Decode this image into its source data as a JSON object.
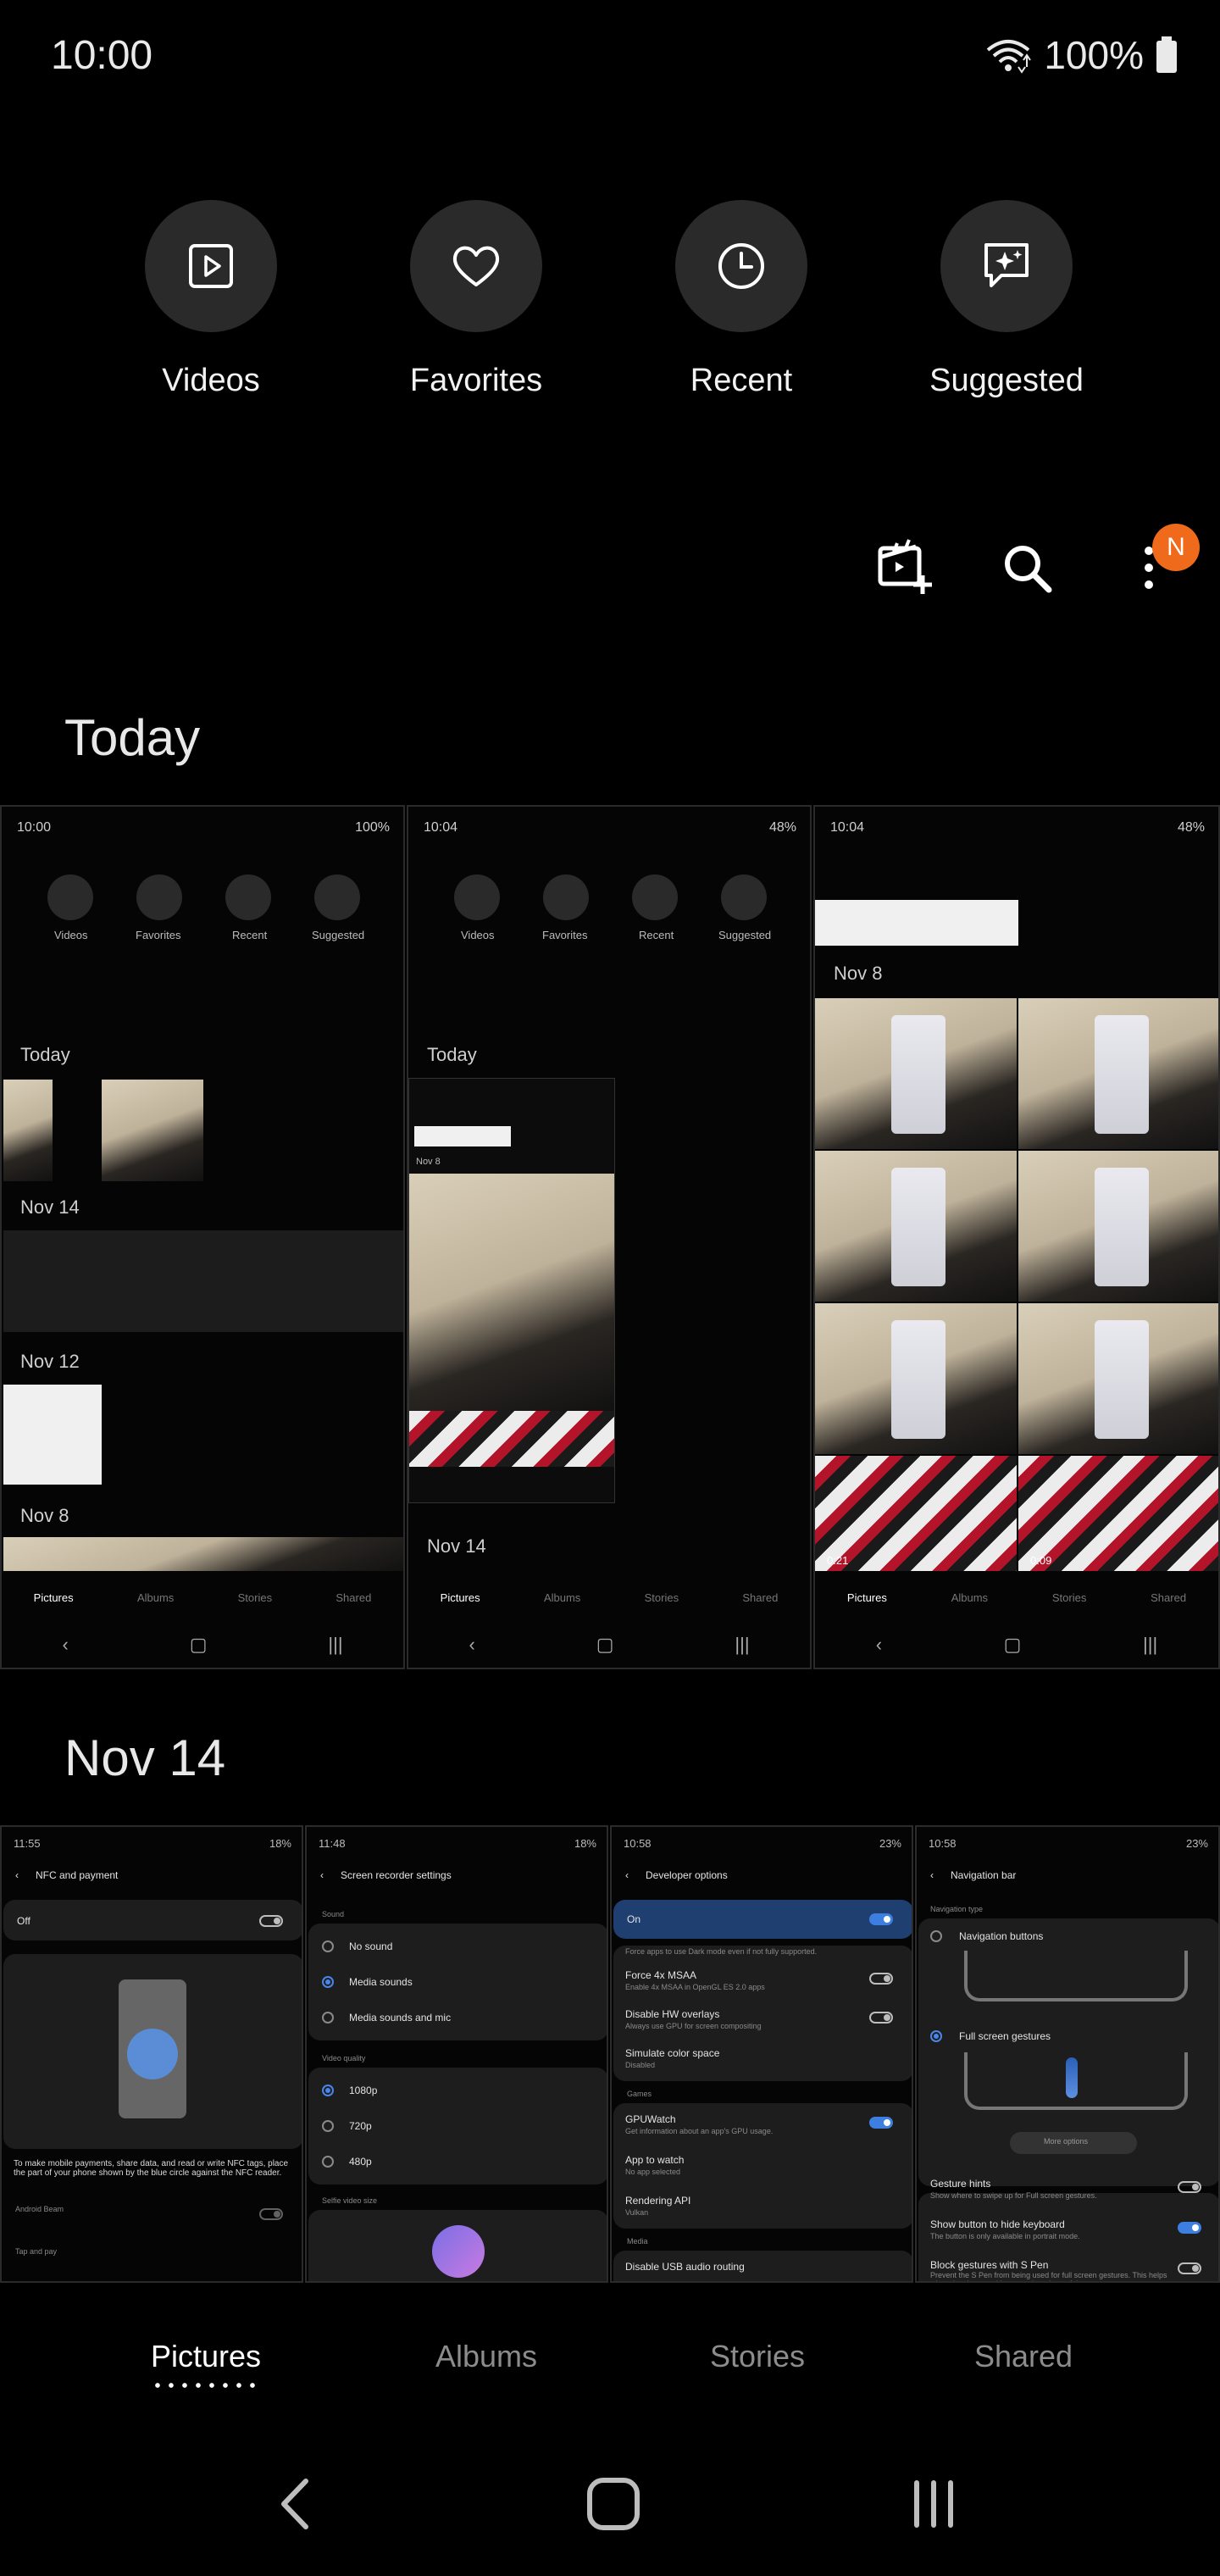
{
  "status": {
    "time": "10:00",
    "battery": "100%"
  },
  "quick_access": [
    {
      "label": "Videos",
      "icon": "play-square-icon"
    },
    {
      "label": "Favorites",
      "icon": "heart-icon"
    },
    {
      "label": "Recent",
      "icon": "clock-icon"
    },
    {
      "label": "Suggested",
      "icon": "sparkle-chat-icon"
    }
  ],
  "toolbar": {
    "badge": "N"
  },
  "sections": [
    {
      "title": "Today"
    },
    {
      "title": "Nov 14"
    }
  ],
  "today_shots": [
    {
      "time": "10:00",
      "battery": "100%",
      "labels": [
        "Videos",
        "Favorites",
        "Recent",
        "Suggested"
      ],
      "headers": [
        "Today",
        "Nov 14",
        "Nov 12",
        "Nov 8"
      ]
    },
    {
      "time": "10:04",
      "battery": "48%",
      "labels": [
        "Videos",
        "Favorites",
        "Recent",
        "Suggested"
      ],
      "headers": [
        "Today",
        "Nov 8",
        "Nov 14"
      ]
    },
    {
      "time": "10:04",
      "battery": "48%",
      "headers": [
        "Nov 8"
      ],
      "video_durations": [
        "0:21",
        "0:09"
      ]
    }
  ],
  "mini_tabs": [
    "Pictures",
    "Albums",
    "Stories",
    "Shared"
  ],
  "nov14_shots": {
    "nfc": {
      "time": "11:55",
      "battery": "18%",
      "title": "NFC and payment",
      "off_label": "Off",
      "desc": "To make mobile payments, share data, and read or write NFC tags, place the part of your phone shown by the blue circle against the NFC reader.",
      "row1": "Android Beam",
      "row2": "Tap and pay"
    },
    "recorder": {
      "time": "11:48",
      "battery": "18%",
      "title": "Screen recorder settings",
      "sound_header": "Sound",
      "sound_options": [
        "No sound",
        "Media sounds",
        "Media sounds and mic"
      ],
      "quality_header": "Video quality",
      "quality_options": [
        "1080p",
        "720p",
        "480p"
      ],
      "selfie_header": "Selfie video size"
    },
    "developer": {
      "time": "10:58",
      "battery": "23%",
      "title": "Developer options",
      "on_label": "On",
      "row0_sub": "Force apps to use Dark mode even if not fully supported.",
      "rows": [
        {
          "title": "Force 4x MSAA",
          "sub": "Enable 4x MSAA in OpenGL ES 2.0 apps"
        },
        {
          "title": "Disable HW overlays",
          "sub": "Always use GPU for screen compositing"
        },
        {
          "title": "Simulate color space",
          "sub": "Disabled"
        }
      ],
      "games_header": "Games",
      "rows2": [
        {
          "title": "GPUWatch",
          "sub": "Get information about an app's GPU usage."
        },
        {
          "title": "App to watch",
          "sub": "No app selected"
        },
        {
          "title": "Rendering API",
          "sub": "Vulkan"
        }
      ],
      "media_header": "Media",
      "last_row": "Disable USB audio routing"
    },
    "navbar": {
      "time": "10:58",
      "battery": "23%",
      "title": "Navigation bar",
      "type_header": "Navigation type",
      "opt1": "Navigation buttons",
      "opt2": "Full screen gestures",
      "more": "More options",
      "rows": [
        {
          "title": "Gesture hints",
          "sub": "Show where to swipe up for Full screen gestures."
        },
        {
          "title": "Show button to hide keyboard",
          "sub": "The button is only available in portrait mode."
        },
        {
          "title": "Block gestures with S Pen",
          "sub": "Prevent the S Pen from being used for full screen gestures. This helps when drawing or writing near the edges of the screen."
        }
      ]
    }
  },
  "bottom_tabs": [
    "Pictures",
    "Albums",
    "Stories",
    "Shared"
  ]
}
